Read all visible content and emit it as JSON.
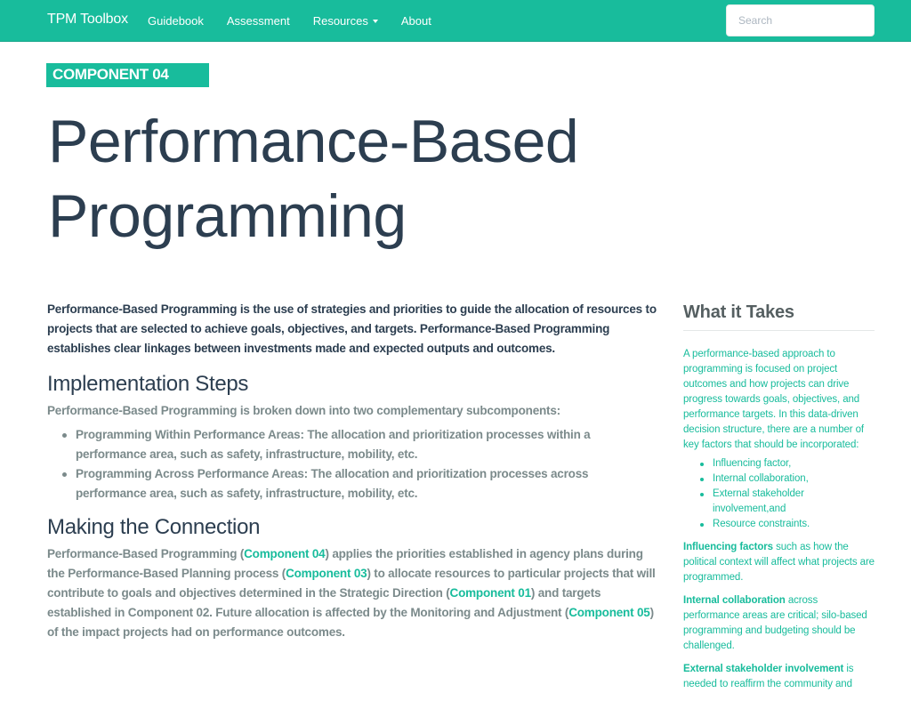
{
  "navbar": {
    "brand": "TPM Toolbox",
    "links": [
      {
        "label": "Guidebook"
      },
      {
        "label": "Assessment"
      },
      {
        "label": "Resources",
        "has_dropdown": true
      },
      {
        "label": "About"
      }
    ],
    "search": {
      "placeholder": "Search",
      "value": ""
    }
  },
  "header": {
    "badge": "COMPONENT 04",
    "title": "Performance-Based Programming"
  },
  "main": {
    "lead": "Performance-Based Programming is the use of strategies and priorities to guide the allocation of resources to projects that are selected to achieve goals, objectives, and targets. Performance-Based Programming establishes clear linkages between investments made and expected outputs and outcomes.",
    "implementation": {
      "heading": "Implementation Steps",
      "intro": "Performance-Based Programming is broken down into two complementary subcomponents:",
      "items": [
        "Programming Within Performance Areas: The allocation and prioritization processes within a performance area, such as safety, infrastructure, mobility, etc.",
        "Programming Across Performance Areas: The allocation and prioritization processes across performance area, such as safety, infrastructure, mobility, etc."
      ]
    },
    "connection": {
      "heading": "Making the Connection",
      "segments": {
        "s1": "Performance-Based Programming (",
        "l1": "Component 04",
        "s2": ") applies the priorities established in agency plans during the Performance-Based Planning process (",
        "l2": "Component 03",
        "s3": ") to allocate resources to particular projects that will contribute to goals and objectives determined in the Strategic Direction (",
        "l3": "Component 01",
        "s4": ") and targets established in Component 02. Future allocation is affected by the Monitoring and Adjustment (",
        "l4": "Component 05",
        "s5": ") of the impact projects had on performance outcomes."
      }
    }
  },
  "sidebar": {
    "title": "What it Takes",
    "intro": "A performance-based approach to programming is focused on project outcomes and how projects can drive progress towards goals, objectives, and performance targets. In this data-driven decision structure, there are a number of key factors that should be incorporated:",
    "factors": [
      "Influencing factor,",
      "Internal collaboration,",
      "External stakeholder involvement,and",
      "Resource constraints."
    ],
    "paragraphs": [
      {
        "bold": "Influencing factors",
        "text": " such as how the political context will affect what projects are programmed."
      },
      {
        "bold": "Internal collaboration",
        "text": " across performance areas are critical; silo-based programming and budgeting should be challenged."
      },
      {
        "bold": "External stakeholder involvement",
        "text": " is needed to reaffirm the community and"
      }
    ]
  },
  "colors": {
    "brand": "#18bc9c",
    "heading": "#2c3e50",
    "muted": "#7b8a8b"
  }
}
